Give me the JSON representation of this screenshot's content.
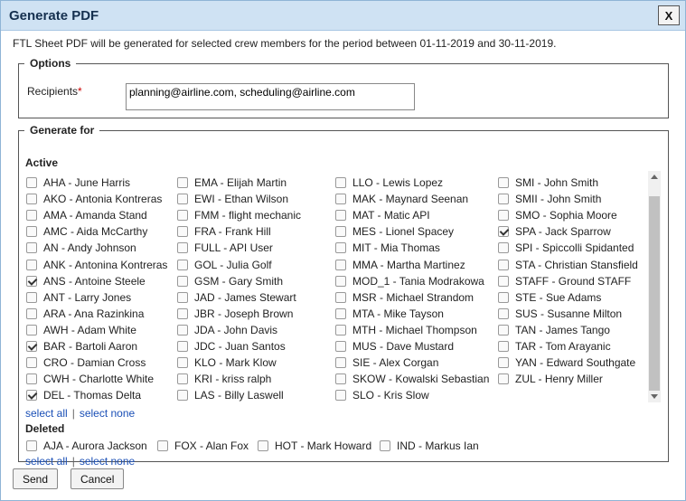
{
  "dialog": {
    "title": "Generate PDF",
    "close_label": "X",
    "info": "FTL Sheet PDF will be generated for selected crew members for the period between 01-11-2019 and 30-11-2019."
  },
  "options": {
    "legend": "Options",
    "recipients_label": "Recipients",
    "required_mark": "*",
    "recipients_value": "planning@airline.com, scheduling@airline.com"
  },
  "generate_for": {
    "legend": "Generate for",
    "active_title": "Active",
    "deleted_title": "Deleted",
    "select_all": "select all",
    "select_none": "select none",
    "separator": "|",
    "active_columns": [
      [
        {
          "label": "AHA - June Harris",
          "checked": false
        },
        {
          "label": "AKO - Antonia Kontreras",
          "checked": false
        },
        {
          "label": "AMA - Amanda Stand",
          "checked": false
        },
        {
          "label": "AMC - Aida McCarthy",
          "checked": false
        },
        {
          "label": "AN - Andy Johnson",
          "checked": false
        },
        {
          "label": "ANK - Antonina Kontreras",
          "checked": false
        },
        {
          "label": "ANS - Antoine Steele",
          "checked": true
        },
        {
          "label": "ANT - Larry Jones",
          "checked": false
        },
        {
          "label": "ARA - Ana Razinkina",
          "checked": false
        },
        {
          "label": "AWH - Adam White",
          "checked": false
        },
        {
          "label": "BAR - Bartoli Aaron",
          "checked": true
        },
        {
          "label": "CRO - Damian Cross",
          "checked": false
        },
        {
          "label": "CWH - Charlotte White",
          "checked": false
        },
        {
          "label": "DEL - Thomas Delta",
          "checked": true
        }
      ],
      [
        {
          "label": "EMA - Elijah Martin",
          "checked": false
        },
        {
          "label": "EWI - Ethan Wilson",
          "checked": false
        },
        {
          "label": "FMM - flight mechanic",
          "checked": false
        },
        {
          "label": "FRA - Frank Hill",
          "checked": false
        },
        {
          "label": "FULL - API User",
          "checked": false
        },
        {
          "label": "GOL - Julia Golf",
          "checked": false
        },
        {
          "label": "GSM - Gary Smith",
          "checked": false
        },
        {
          "label": "JAD - James Stewart",
          "checked": false
        },
        {
          "label": "JBR - Joseph Brown",
          "checked": false
        },
        {
          "label": "JDA - John Davis",
          "checked": false
        },
        {
          "label": "JDC - Juan Santos",
          "checked": false
        },
        {
          "label": "KLO - Mark Klow",
          "checked": false
        },
        {
          "label": "KRI - kriss ralph",
          "checked": false
        },
        {
          "label": "LAS - Billy Laswell",
          "checked": false
        }
      ],
      [
        {
          "label": "LLO - Lewis Lopez",
          "checked": false
        },
        {
          "label": "MAK - Maynard Seenan",
          "checked": false
        },
        {
          "label": "MAT - Matic API",
          "checked": false
        },
        {
          "label": "MES - Lionel Spacey",
          "checked": false
        },
        {
          "label": "MIT - Mia Thomas",
          "checked": false
        },
        {
          "label": "MMA - Martha Martinez",
          "checked": false
        },
        {
          "label": "MOD_1 - Tania Modrakowa",
          "checked": false
        },
        {
          "label": "MSR - Michael Strandom",
          "checked": false
        },
        {
          "label": "MTA - Mike Tayson",
          "checked": false
        },
        {
          "label": "MTH - Michael Thompson",
          "checked": false
        },
        {
          "label": "MUS - Dave Mustard",
          "checked": false
        },
        {
          "label": "SIE - Alex Corgan",
          "checked": false
        },
        {
          "label": "SKOW - Kowalski Sebastian",
          "checked": false
        },
        {
          "label": "SLO - Kris Slow",
          "checked": false
        }
      ],
      [
        {
          "label": "SMI - John Smith",
          "checked": false
        },
        {
          "label": "SMII - John Smith",
          "checked": false
        },
        {
          "label": "SMO - Sophia Moore",
          "checked": false
        },
        {
          "label": "SPA - Jack Sparrow",
          "checked": true
        },
        {
          "label": "SPI - Spiccolli Spidanted",
          "checked": false
        },
        {
          "label": "STA - Christian Stansfield",
          "checked": false
        },
        {
          "label": "STAFF - Ground STAFF",
          "checked": false
        },
        {
          "label": "STE - Sue Adams",
          "checked": false
        },
        {
          "label": "SUS - Susanne Milton",
          "checked": false
        },
        {
          "label": "TAN - James Tango",
          "checked": false
        },
        {
          "label": "TAR - Tom Arayanic",
          "checked": false
        },
        {
          "label": "YAN - Edward Southgate",
          "checked": false
        },
        {
          "label": "ZUL - Henry Miller",
          "checked": false
        }
      ]
    ],
    "deleted": [
      {
        "label": "AJA - Aurora Jackson",
        "checked": false
      },
      {
        "label": "FOX - Alan Fox",
        "checked": false
      },
      {
        "label": "HOT - Mark Howard",
        "checked": false
      },
      {
        "label": "IND - Markus Ian",
        "checked": false
      }
    ]
  },
  "footer": {
    "send_label": "Send",
    "cancel_label": "Cancel"
  }
}
